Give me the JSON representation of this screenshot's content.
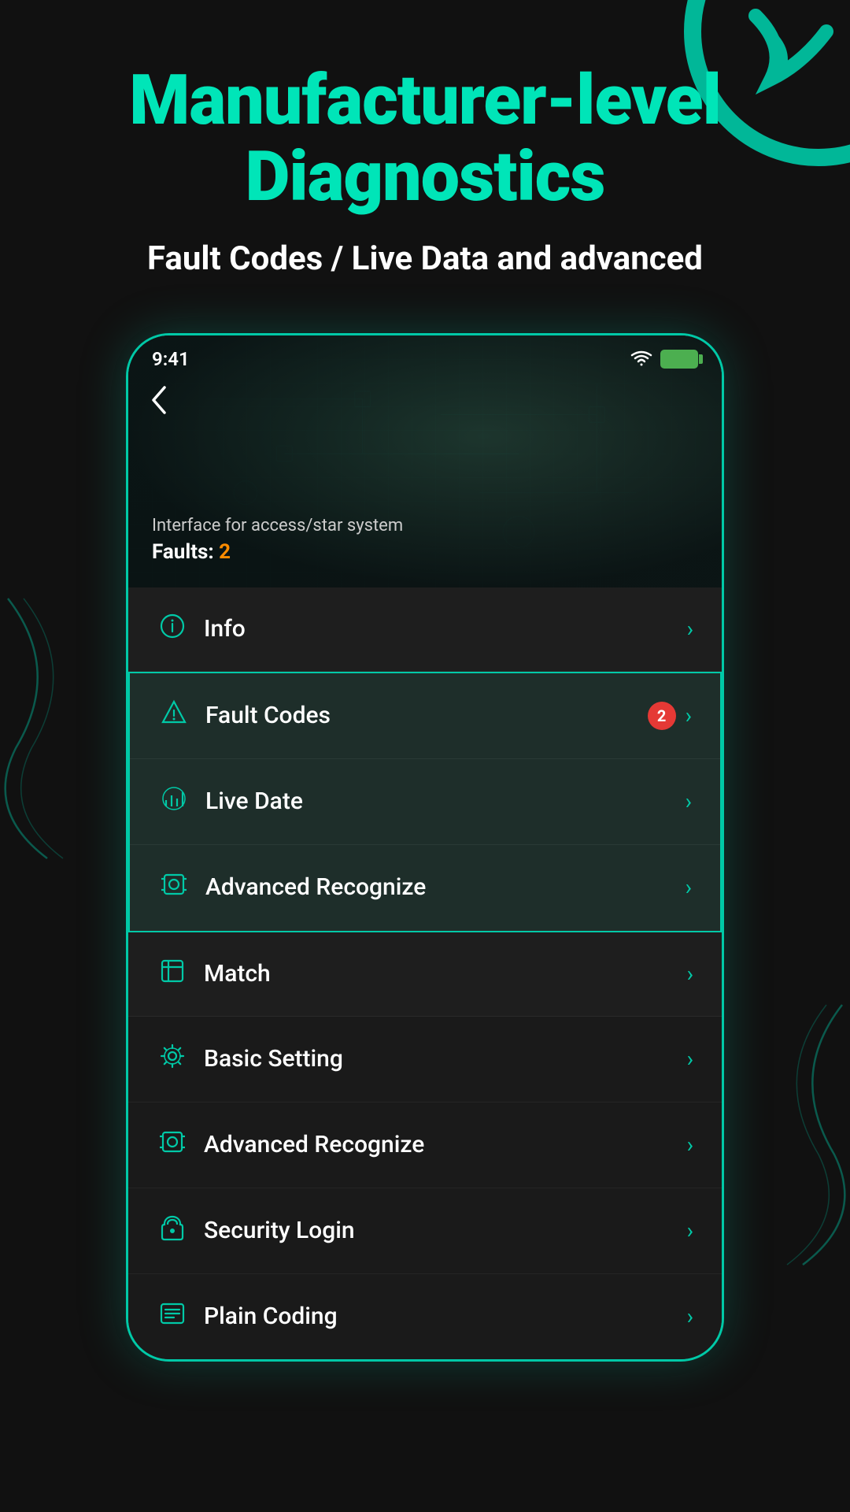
{
  "header": {
    "title_line1": "Manufacturer-level",
    "title_line2": "Diagnostics",
    "subtitle": "Fault Codes / Live Data and advanced"
  },
  "status_bar": {
    "time": "9:41"
  },
  "phone_screen": {
    "interface_label": "Interface for access/star system",
    "faults_label": "Faults:",
    "fault_count": "2",
    "back_icon": "‹",
    "menu_items": [
      {
        "id": "info",
        "label": "Info",
        "icon_type": "info",
        "has_badge": false,
        "highlighted": false
      },
      {
        "id": "fault-codes",
        "label": "Fault Codes",
        "icon_type": "warning",
        "has_badge": true,
        "badge_count": "2",
        "highlighted": true
      },
      {
        "id": "live-date",
        "label": "Live Date",
        "icon_type": "bar-chart",
        "has_badge": false,
        "highlighted": true
      },
      {
        "id": "advanced-recognize-top",
        "label": "Advanced Recognize",
        "icon_type": "scan",
        "has_badge": false,
        "highlighted": true
      },
      {
        "id": "match",
        "label": "Match",
        "icon_type": "match",
        "has_badge": false,
        "partial": true
      }
    ]
  },
  "bottom_list": {
    "items": [
      {
        "id": "basic-setting",
        "label": "Basic Setting",
        "icon_type": "gear"
      },
      {
        "id": "advanced-recognize",
        "label": "Advanced Recognize",
        "icon_type": "scan"
      },
      {
        "id": "security-login",
        "label": "Security Login",
        "icon_type": "shield"
      },
      {
        "id": "plain-coding",
        "label": "Plain Coding",
        "icon_type": "list"
      }
    ]
  },
  "chevron": "›",
  "colors": {
    "accent": "#00c9a7",
    "badge": "#e53935",
    "fault_count_color": "#ff8c00"
  }
}
